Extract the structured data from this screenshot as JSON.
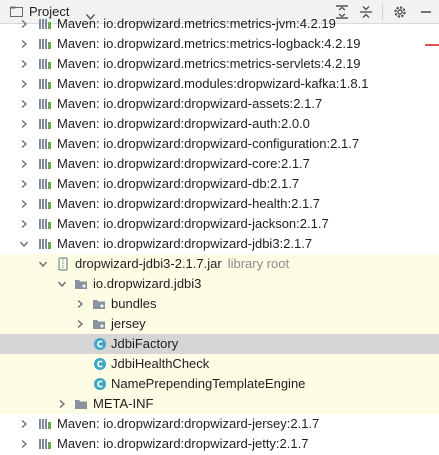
{
  "header": {
    "title": "Project"
  },
  "tree": {
    "rows": [
      {
        "label": "Maven: io.dropwizard.metrics:metrics-jvm:4.2.19"
      },
      {
        "label": "Maven: io.dropwizard.metrics:metrics-logback:4.2.19"
      },
      {
        "label": "Maven: io.dropwizard.metrics:metrics-servlets:4.2.19"
      },
      {
        "label": "Maven: io.dropwizard.modules:dropwizard-kafka:1.8.1"
      },
      {
        "label": "Maven: io.dropwizard:dropwizard-assets:2.1.7"
      },
      {
        "label": "Maven: io.dropwizard:dropwizard-auth:2.0.0"
      },
      {
        "label": "Maven: io.dropwizard:dropwizard-configuration:2.1.7"
      },
      {
        "label": "Maven: io.dropwizard:dropwizard-core:2.1.7"
      },
      {
        "label": "Maven: io.dropwizard:dropwizard-db:2.1.7"
      },
      {
        "label": "Maven: io.dropwizard:dropwizard-health:2.1.7"
      },
      {
        "label": "Maven: io.dropwizard:dropwizard-jackson:2.1.7"
      },
      {
        "label": "Maven: io.dropwizard:dropwizard-jdbi3:2.1.7"
      },
      {
        "label": "dropwizard-jdbi3-2.1.7.jar",
        "suffix": "library root"
      },
      {
        "label": "io.dropwizard.jdbi3"
      },
      {
        "label": "bundles"
      },
      {
        "label": "jersey"
      },
      {
        "label": "JdbiFactory"
      },
      {
        "label": "JdbiHealthCheck"
      },
      {
        "label": "NamePrependingTemplateEngine"
      },
      {
        "label": "META-INF"
      },
      {
        "label": "Maven: io.dropwizard:dropwizard-jersey:2.1.7"
      },
      {
        "label": "Maven: io.dropwizard:dropwizard-jetty:2.1.7"
      }
    ]
  },
  "colors": {
    "library_root_bg": "#fdfde5",
    "selected_bg": "#d5d5d5",
    "class_icon": "#3fa8c8",
    "folder_icon": "#8a949e"
  }
}
